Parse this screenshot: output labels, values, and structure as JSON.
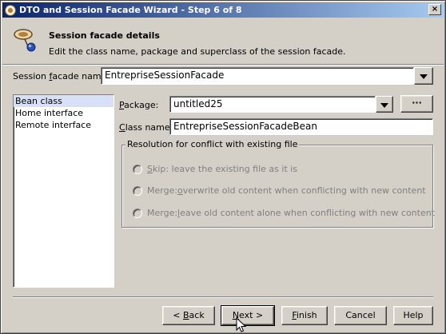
{
  "window": {
    "title": "DTO and Session Facade Wizard - Step 6 of 8",
    "close_glyph": "×"
  },
  "header": {
    "title": "Session facade details",
    "description": "Edit the class name, package and superclass of the session facade."
  },
  "facade": {
    "label_pre": "Session ",
    "label_mnemonic": "f",
    "label_post": "acade name:",
    "value": "EntrepriseSessionFacade"
  },
  "nav": {
    "items": [
      {
        "label": "Bean class",
        "selected": true
      },
      {
        "label": "Home interface",
        "selected": false
      },
      {
        "label": "Remote interface",
        "selected": false
      }
    ]
  },
  "package": {
    "label_mnemonic": "P",
    "label_post": "ackage:",
    "value": "untitled25",
    "browse_label": "···"
  },
  "class_name": {
    "label_mnemonic": "C",
    "label_post": "lass name:",
    "value": "EntrepriseSessionFacadeBean"
  },
  "conflict": {
    "legend": "Resolution for conflict with existing file",
    "options": [
      {
        "mnemonic": "S",
        "text": "kip: leave the existing file as it is",
        "prefix": ""
      },
      {
        "mnemonic": "o",
        "text": "verwrite old content when conflicting with new content",
        "prefix": "Merge: "
      },
      {
        "mnemonic": "l",
        "text": "eave old content alone when conflicting with new content",
        "prefix": "Merge: "
      }
    ]
  },
  "buttons": {
    "back_pre": "< ",
    "back_mnemonic": "B",
    "back_post": "ack",
    "next_mnemonic": "N",
    "next_post": "ext >",
    "finish_mnemonic": "F",
    "finish_post": "inish",
    "cancel": "Cancel",
    "help": "Help"
  }
}
